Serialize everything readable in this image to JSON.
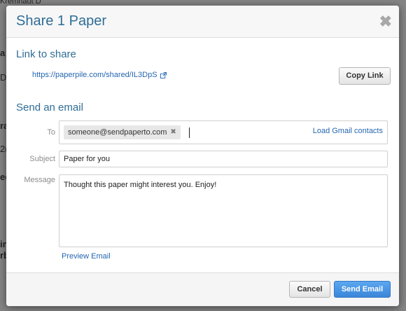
{
  "backdrop": {
    "fragments": [
      "Kremhaut D",
      "a",
      "D",
      "ra",
      "2(",
      "ec",
      "in",
      "rb"
    ]
  },
  "modal": {
    "title": "Share 1 Paper",
    "close_icon": "close-icon"
  },
  "link_section": {
    "title": "Link to share",
    "url": "https://paperpile.com/shared/IL3DpS",
    "copy_button_label": "Copy Link"
  },
  "email_section": {
    "title": "Send an email",
    "to_label": "To",
    "recipients": [
      "someone@sendpaperto.com"
    ],
    "load_contacts_label": "Load Gmail contacts",
    "subject_label": "Subject",
    "subject_value": "Paper for you",
    "message_label": "Message",
    "message_value": "Thought this paper might interest you. Enjoy!",
    "preview_label": "Preview Email"
  },
  "footer": {
    "cancel_label": "Cancel",
    "send_label": "Send Email"
  },
  "colors": {
    "title": "#2f6d95",
    "link": "#2566b0",
    "primary_button": "#3b86d9"
  }
}
